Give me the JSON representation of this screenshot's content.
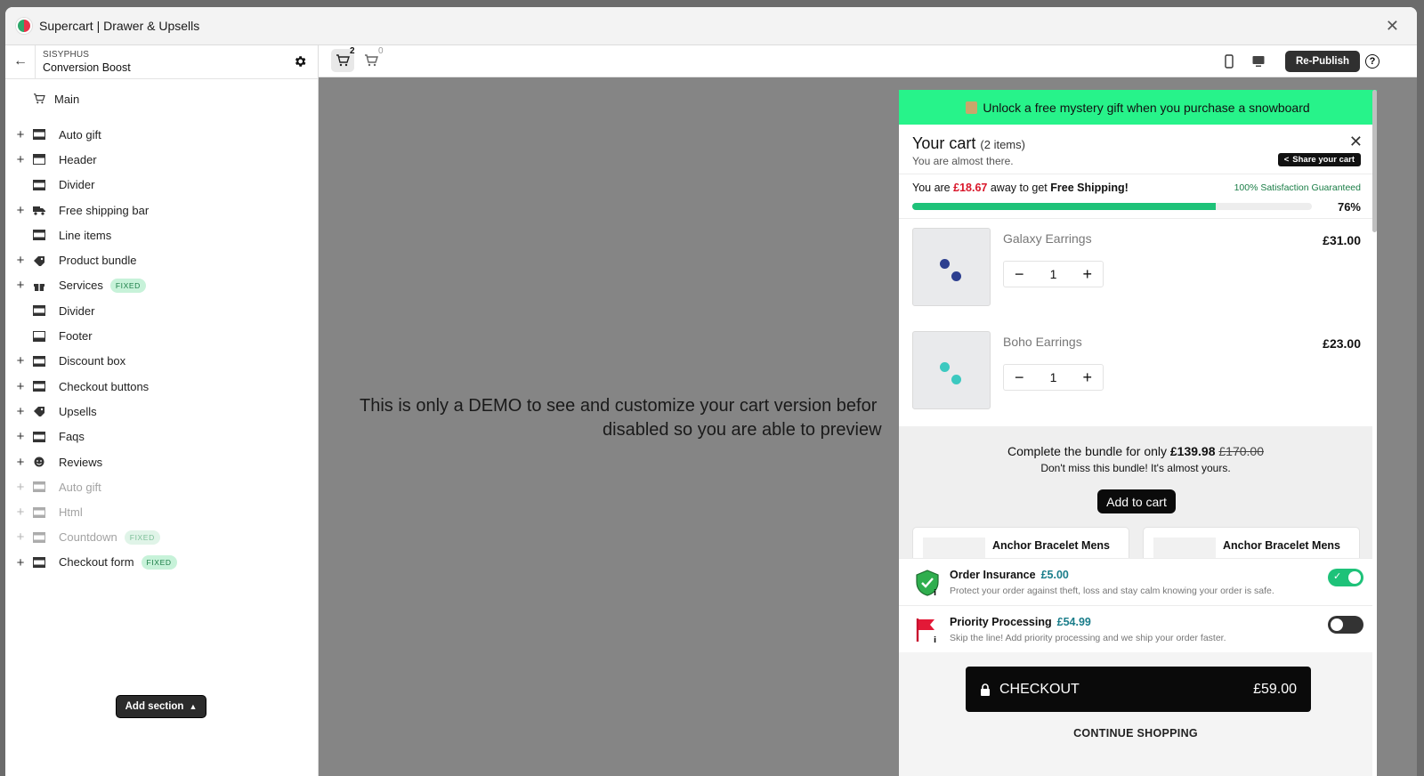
{
  "app": {
    "title": "Supercart | Drawer & Upsells"
  },
  "sidebar": {
    "store_sub": "SISYPHUS",
    "store_name": "Conversion Boost",
    "main_label": "Main",
    "items": [
      {
        "label": "Auto gift",
        "plus": "+",
        "icon": "layout-block-icon",
        "dim": false,
        "badge": ""
      },
      {
        "label": "Header",
        "plus": "+",
        "icon": "header-block-icon",
        "dim": false,
        "badge": ""
      },
      {
        "label": "Divider",
        "plus": "",
        "icon": "layout-block-icon",
        "dim": false,
        "badge": ""
      },
      {
        "label": "Free shipping bar",
        "plus": "+",
        "icon": "truck-icon",
        "dim": false,
        "badge": ""
      },
      {
        "label": "Line items",
        "plus": "",
        "icon": "layout-block-icon",
        "dim": false,
        "badge": ""
      },
      {
        "label": "Product bundle",
        "plus": "+",
        "icon": "tag-icon",
        "dim": false,
        "badge": ""
      },
      {
        "label": "Services",
        "plus": "+",
        "icon": "gift-icon",
        "dim": false,
        "badge": "FIXED"
      },
      {
        "label": "Divider",
        "plus": "",
        "icon": "layout-block-icon",
        "dim": false,
        "badge": ""
      },
      {
        "label": "Footer",
        "plus": "",
        "icon": "footer-block-icon",
        "dim": false,
        "badge": ""
      },
      {
        "label": "Discount box",
        "plus": "+",
        "icon": "layout-block-icon",
        "dim": false,
        "badge": ""
      },
      {
        "label": "Checkout buttons",
        "plus": "+",
        "icon": "layout-block-icon",
        "dim": false,
        "badge": ""
      },
      {
        "label": "Upsells",
        "plus": "+",
        "icon": "tag-icon",
        "dim": false,
        "badge": ""
      },
      {
        "label": "Faqs",
        "plus": "+",
        "icon": "layout-block-icon",
        "dim": false,
        "badge": ""
      },
      {
        "label": "Reviews",
        "plus": "+",
        "icon": "smiley-icon",
        "dim": false,
        "badge": ""
      },
      {
        "label": "Auto gift",
        "plus": "+",
        "icon": "layout-block-icon",
        "dim": true,
        "badge": ""
      },
      {
        "label": "Html",
        "plus": "+",
        "icon": "layout-block-icon",
        "dim": true,
        "badge": ""
      },
      {
        "label": "Countdown",
        "plus": "+",
        "icon": "layout-block-icon",
        "dim": true,
        "badge": "FIXED"
      },
      {
        "label": "Checkout form",
        "plus": "+",
        "icon": "layout-block-icon",
        "dim": false,
        "badge": "FIXED"
      }
    ],
    "add_section_label": "Add section"
  },
  "toolbar": {
    "cart_full_count": "2",
    "cart_empty_count": "0",
    "republish_label": "Re-Publish",
    "help_label": "?"
  },
  "preview": {
    "demo_line1": "This is only a DEMO to see and customize your cart version befor",
    "demo_line2": "disabled so you are able to preview"
  },
  "drawer": {
    "promo": "Unlock a free mystery gift when you purchase a snowboard",
    "title": "Your cart",
    "count_text": "(2 items)",
    "subtitle": "You are almost there.",
    "share_label": "Share your cart",
    "shipping": {
      "prefix": "You are",
      "amount": "£18.67",
      "middle": "away to get",
      "goal": "Free Shipping!",
      "guarantee": "100% Satisfaction Guaranteed",
      "percent_label": "76%",
      "progress": 76
    },
    "line_items": [
      {
        "name": "Galaxy Earrings",
        "price": "£31.00",
        "qty": "1",
        "gem_color": "#2d3f8f"
      },
      {
        "name": "Boho Earrings",
        "price": "£23.00",
        "qty": "1",
        "gem_color": "#3cc9c0"
      }
    ],
    "bundle": {
      "line1_prefix": "Complete the bundle for only",
      "price": "£139.98",
      "old_price": "£170.00",
      "line2": "Don't miss this bundle! It's almost yours.",
      "add_label": "Add to cart",
      "cards": [
        "Anchor Bracelet Mens",
        "Anchor Bracelet Mens"
      ]
    },
    "addons": [
      {
        "name": "Order Insurance",
        "price": "£5.00",
        "desc": "Protect your order against theft, loss and stay calm knowing your order is safe.",
        "on": true
      },
      {
        "name": "Priority Processing",
        "price": "£54.99",
        "desc": "Skip the line! Add priority processing and we ship your order faster.",
        "on": false
      }
    ],
    "checkout_label": "CHECKOUT",
    "checkout_price": "£59.00",
    "continue_label": "CONTINUE SHOPPING"
  },
  "colors": {
    "accent_green": "#1ec279",
    "promo_green": "#27f38a",
    "alert_red": "#d9162a"
  }
}
